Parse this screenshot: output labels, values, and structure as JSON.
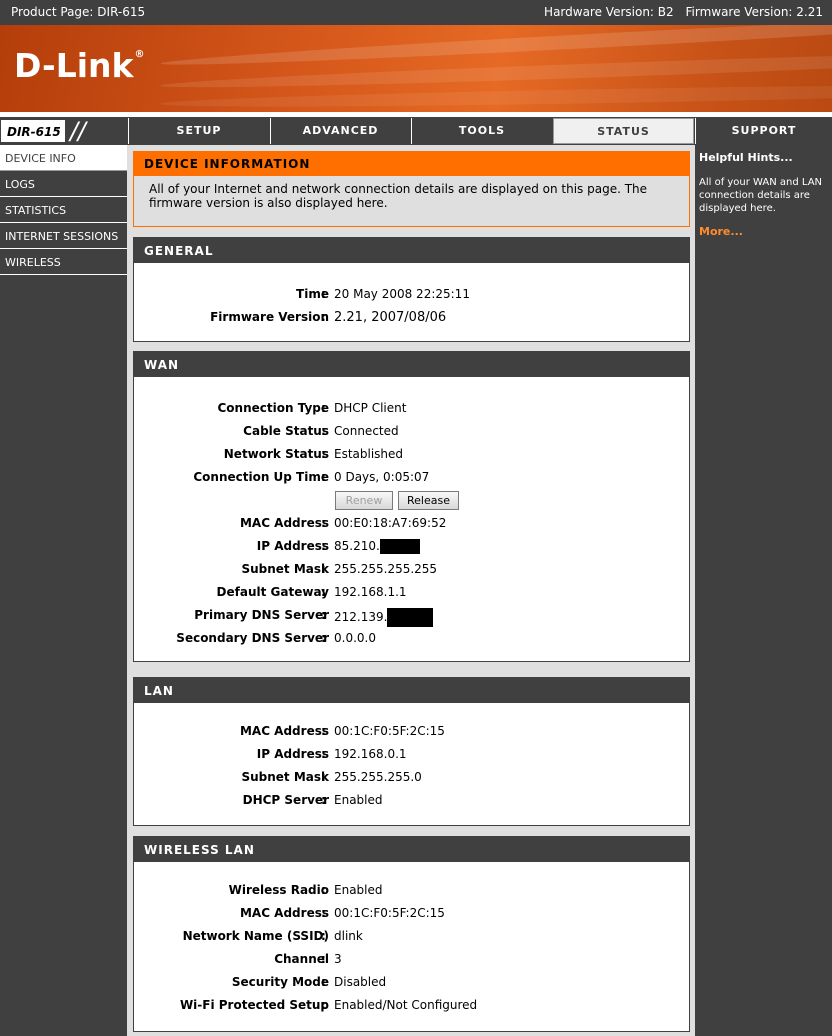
{
  "topbar": {
    "product_page": "Product Page: DIR-615",
    "hardware_version": "Hardware Version: B2",
    "firmware_version": "Firmware Version: 2.21"
  },
  "brand": {
    "logo_text": "D-Link",
    "registered": "®"
  },
  "nav": {
    "model": "DIR-615",
    "tabs": [
      {
        "label": "SETUP"
      },
      {
        "label": "ADVANCED"
      },
      {
        "label": "TOOLS"
      },
      {
        "label": "STATUS"
      },
      {
        "label": "SUPPORT"
      }
    ],
    "active_tab": "STATUS"
  },
  "sidebar": {
    "items": [
      {
        "label": "DEVICE INFO"
      },
      {
        "label": "LOGS"
      },
      {
        "label": "STATISTICS"
      },
      {
        "label": "INTERNET SESSIONS"
      },
      {
        "label": "WIRELESS"
      }
    ],
    "active_item": "DEVICE INFO"
  },
  "device_info": {
    "title": "DEVICE INFORMATION",
    "description": "All of your Internet and network connection details are displayed on this page. The firmware version is also displayed here."
  },
  "general": {
    "title": "GENERAL",
    "time_label": "Time",
    "time_value": "20 May 2008 22:25:11",
    "firmware_label": "Firmware Version",
    "firmware_value": "2.21,  2007/08/06"
  },
  "wan": {
    "title": "WAN",
    "connection_type_label": "Connection Type",
    "connection_type_value": "DHCP Client",
    "cable_status_label": "Cable Status",
    "cable_status_value": "Connected",
    "network_status_label": "Network Status",
    "network_status_value": "Established",
    "uptime_label": "Connection Up Time",
    "uptime_value": "0 Days, 0:05:07",
    "renew_label": "Renew",
    "release_label": "Release",
    "mac_label": "MAC Address",
    "mac_value": "00:E0:18:A7:69:52",
    "ip_label": "IP Address",
    "ip_value": "85.210.",
    "subnet_label": "Subnet Mask",
    "subnet_value": "255.255.255.255",
    "gateway_label": "Default Gateway",
    "gateway_value": "192.168.1.1",
    "dns1_label": "Primary DNS Server",
    "dns1_value": "212.139.",
    "dns2_label": "Secondary DNS Server",
    "dns2_value": "0.0.0.0"
  },
  "lan": {
    "title": "LAN",
    "mac_label": "MAC Address",
    "mac_value": "00:1C:F0:5F:2C:15",
    "ip_label": "IP Address",
    "ip_value": "192.168.0.1",
    "subnet_label": "Subnet Mask",
    "subnet_value": "255.255.255.0",
    "dhcp_label": "DHCP Server",
    "dhcp_value": "Enabled"
  },
  "wlan": {
    "title": "WIRELESS LAN",
    "radio_label": "Wireless Radio",
    "radio_value": "Enabled",
    "mac_label": "MAC Address",
    "mac_value": "00:1C:F0:5F:2C:15",
    "ssid_label": "Network Name (SSID)",
    "ssid_value": "dlink",
    "channel_label": "Channel",
    "channel_value": "3",
    "security_label": "Security Mode",
    "security_value": "Disabled",
    "wps_label": "Wi-Fi Protected Setup",
    "wps_value": "Enabled/Not Configured"
  },
  "hints": {
    "title": "Helpful Hints...",
    "body": "All of your WAN and LAN connection details are displayed here.",
    "more": "More..."
  },
  "colors": {
    "accent_orange": "#ff6f00",
    "nav_dark": "#404040",
    "link_orange": "#ff8c2c"
  }
}
